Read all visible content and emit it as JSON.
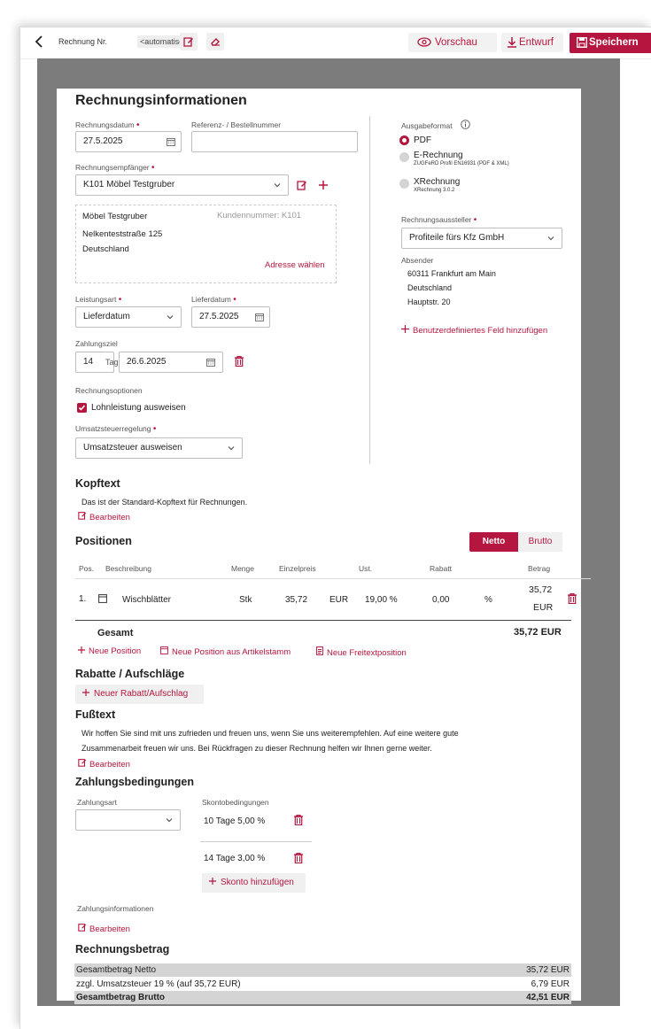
{
  "header": {
    "title_label": "Rechnung Nr.",
    "title_auto": "<automatisch>",
    "preview_label": "Vorschau",
    "draft_label": "Entwurf",
    "save_label": "Speichern"
  },
  "info": {
    "title": "Rechnungsinformationen",
    "invoice_date_label": "Rechnungsdatum",
    "invoice_date_value": "27.5.2025",
    "reference_label": "Referenz- / Bestellnummer",
    "reference_value": "",
    "recipient_label": "Rechnungsempfänger",
    "recipient_value": "K101 Möbel Testgruber",
    "address": {
      "name": "Möbel Testgruber",
      "customer_no": "Kundennummer: K101",
      "street": "Nelkenteststraße 125",
      "country": "Deutschland",
      "choose_link": "Adresse wählen"
    },
    "service_type_label": "Leistungsart",
    "service_type_value": "Lieferdatum",
    "delivery_date_label": "Lieferdatum",
    "delivery_date_value": "27.5.2025",
    "payment_target_label": "Zahlungsziel",
    "payment_days": "14",
    "payment_days_unit": "Tage",
    "payment_date": "26.6.2025",
    "options_label": "Rechnungsoptionen",
    "option_wage": "Lohnleistung ausweisen",
    "vat_rule_label": "Umsatzsteuerregelung",
    "vat_rule_value": "Umsatzsteuer ausweisen"
  },
  "output": {
    "label": "Ausgabeformat",
    "pdf": "PDF",
    "erechnung": "E-Rechnung",
    "erechnung_sub": "ZUGFeRD Profil EN16931 (PDF & XML)",
    "xrechnung": "XRechnung",
    "xrechnung_sub": "XRechnung 3.0.2",
    "issuer_label": "Rechnungsaussteller",
    "issuer_value": "Profiteile fürs Kfz GmbH",
    "sender_label": "Absender",
    "sender_city": "60311 Frankfurt am Main",
    "sender_country": "Deutschland",
    "sender_street": "Hauptstr. 20",
    "custom_field_link": "Benutzerdefiniertes Feld hinzufügen"
  },
  "header_text": {
    "title": "Kopftext",
    "body": "Das ist der Standard-Kopftext für Rechnungen.",
    "edit": "Bearbeiten"
  },
  "positions": {
    "title": "Positionen",
    "toggle_net": "Netto",
    "toggle_gross": "Brutto",
    "columns": [
      "Pos.",
      "Beschreibung",
      "Menge",
      "Einzelpreis",
      "Ust.",
      "Rabatt",
      "Betrag"
    ],
    "row": {
      "pos": "1.",
      "desc": "Wischblätter",
      "qty": "Stk",
      "price": "35,72",
      "currency": "EUR",
      "vat": "19,00 %",
      "discount": "0,00",
      "discount_unit": "%",
      "amount_top": "35,72",
      "amount_bottom": "EUR"
    },
    "total_label": "Gesamt",
    "total_value": "35,72 EUR",
    "new_position": "Neue Position",
    "new_from_master": "Neue Position aus Artikelstamm",
    "new_text_position": "Neue Freitextposition"
  },
  "discounts": {
    "title": "Rabatte / Aufschläge",
    "add": "Neuer Rabatt/Aufschlag"
  },
  "footer_text": {
    "title": "Fußtext",
    "line1": "Wir hoffen Sie sind mit uns zufrieden und freuen uns, wenn Sie uns weiterempfehlen. Auf eine weitere gute",
    "line2": "Zusammenarbeit freuen wir uns. Bei Rückfragen zu dieser Rechnung helfen wir Ihnen gerne weiter.",
    "edit": "Bearbeiten"
  },
  "payment": {
    "title": "Zahlungsbedingungen",
    "method_label": "Zahlungsart",
    "method_value": "",
    "discount_label": "Skontobedingungen",
    "discount1": "10 Tage 5,00 %",
    "discount2": "14 Tage 3,00 %",
    "add_discount": "Skonto hinzufügen",
    "info_label": "Zahlungsinformationen",
    "edit": "Bearbeiten"
  },
  "amount": {
    "title": "Rechnungsbetrag",
    "net_label": "Gesamtbetrag Netto",
    "net_value": "35,72 EUR",
    "vat_label": "zzgl. Umsatzsteuer 19 % (auf 35,72 EUR)",
    "vat_value": "6,79 EUR",
    "gross_label": "Gesamtbetrag Brutto",
    "gross_value": "42,51 EUR"
  },
  "colors": {
    "accent": "#b5163f",
    "grey_frame": "#7c7c7c",
    "row_grey": "#d4d4d4"
  }
}
